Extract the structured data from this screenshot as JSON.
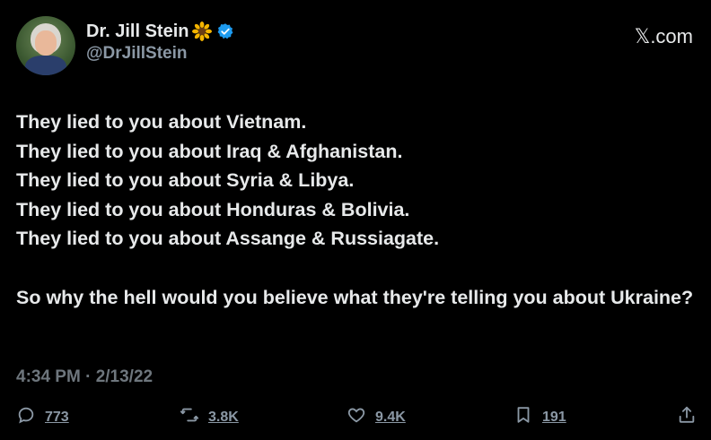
{
  "author": {
    "display_name": "Dr. Jill Stein",
    "handle": "@DrJillStein",
    "badge_icon": "sunflower-icon",
    "verified_icon": "verified-badge-icon",
    "verified_color": "#1d9bf0"
  },
  "brand": {
    "label": "𝕏.com"
  },
  "tweet": {
    "lines": [
      "They lied to you about Vietnam.",
      "They lied to you about Iraq & Afghanistan.",
      "They lied to you about Syria & Libya.",
      "They lied to you about Honduras & Bolivia.",
      "They lied to you about Assange & Russiagate."
    ],
    "closing": "So why the hell would you believe what they're telling you about Ukraine?"
  },
  "timestamp": "4:34 PM · 2/13/22",
  "actions": {
    "reply": {
      "icon": "reply-icon",
      "count": "773"
    },
    "retweet": {
      "icon": "retweet-icon",
      "count": "3.8K"
    },
    "like": {
      "icon": "heart-icon",
      "count": "9.4K"
    },
    "bookmark": {
      "icon": "bookmark-icon",
      "count": "191"
    },
    "share": {
      "icon": "share-icon"
    }
  },
  "colors": {
    "background": "#000000",
    "text": "#e7e9ea",
    "muted": "#8b98a5"
  }
}
